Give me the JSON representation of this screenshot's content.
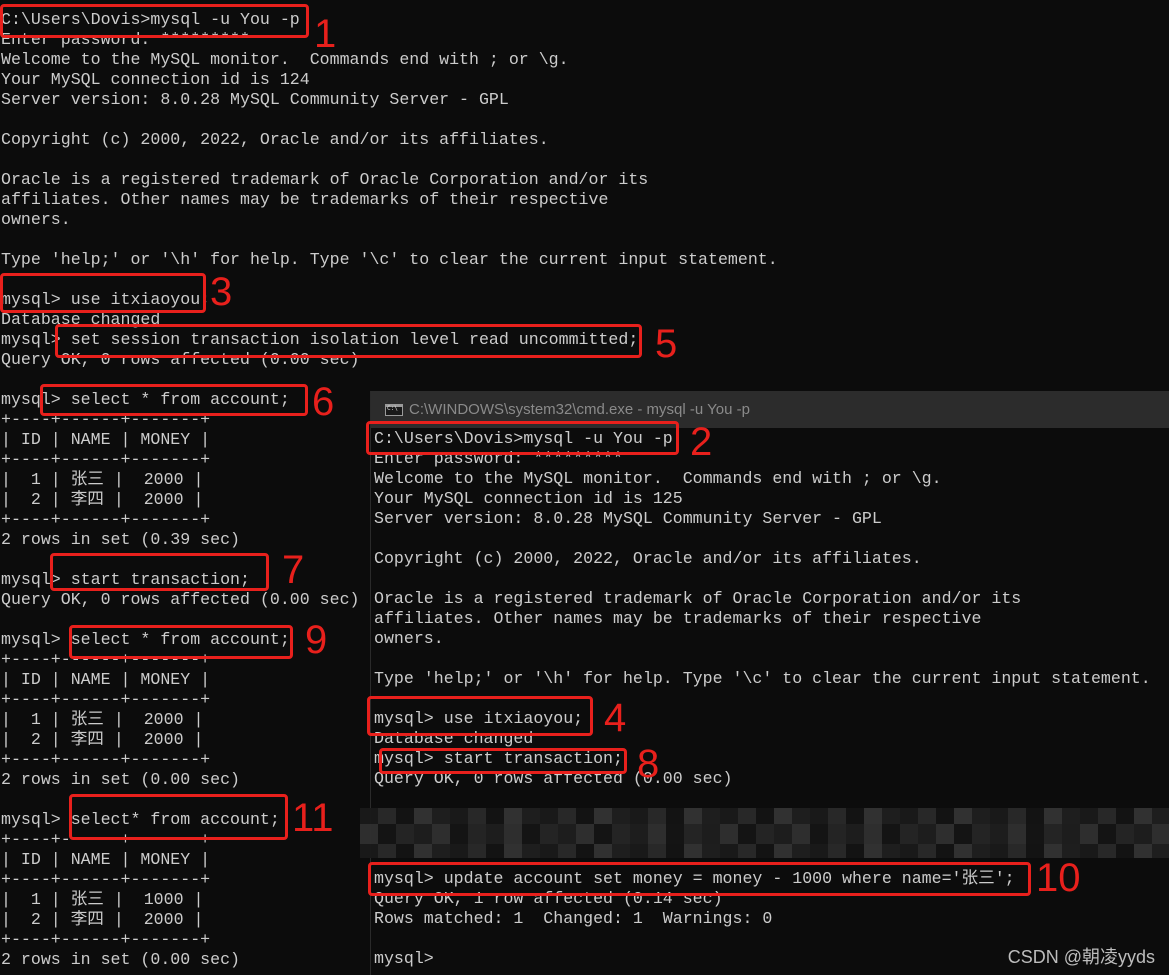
{
  "window1": {
    "lines": [
      "C:\\Users\\Dovis>mysql -u You -p",
      "Enter password: *********",
      "Welcome to the MySQL monitor.  Commands end with ; or \\g.",
      "Your MySQL connection id is 124",
      "Server version: 8.0.28 MySQL Community Server - GPL",
      "",
      "Copyright (c) 2000, 2022, Oracle and/or its affiliates.",
      "",
      "Oracle is a registered trademark of Oracle Corporation and/or its",
      "affiliates. Other names may be trademarks of their respective",
      "owners.",
      "",
      "Type 'help;' or '\\h' for help. Type '\\c' to clear the current input statement.",
      "",
      "mysql> use itxiaoyou;",
      "Database changed",
      "mysql> set session transaction isolation level read uncommitted;",
      "Query OK, 0 rows affected (0.00 sec)",
      "",
      "mysql> select * from account;",
      "+----+------+-------+",
      "| ID | NAME | MONEY |",
      "+----+------+-------+",
      "|  1 | 张三 |  2000 |",
      "|  2 | 李四 |  2000 |",
      "+----+------+-------+",
      "2 rows in set (0.39 sec)",
      "",
      "mysql> start transaction;",
      "Query OK, 0 rows affected (0.00 sec)",
      "",
      "mysql> select * from account;",
      "+----+------+-------+",
      "| ID | NAME | MONEY |",
      "+----+------+-------+",
      "|  1 | 张三 |  2000 |",
      "|  2 | 李四 |  2000 |",
      "+----+------+-------+",
      "2 rows in set (0.00 sec)",
      "",
      "mysql> select* from account;",
      "+----+------+-------+",
      "| ID | NAME | MONEY |",
      "+----+------+-------+",
      "|  1 | 张三 |  1000 |",
      "|  2 | 李四 |  2000 |",
      "+----+------+-------+",
      "2 rows in set (0.00 sec)"
    ]
  },
  "window2": {
    "title": "C:\\WINDOWS\\system32\\cmd.exe - mysql  -u You -p",
    "icon": "cmd-icon",
    "lines": [
      "C:\\Users\\Dovis>mysql -u You -p",
      "Enter password: *********",
      "Welcome to the MySQL monitor.  Commands end with ; or \\g.",
      "Your MySQL connection id is 125",
      "Server version: 8.0.28 MySQL Community Server - GPL",
      "",
      "Copyright (c) 2000, 2022, Oracle and/or its affiliates.",
      "",
      "Oracle is a registered trademark of Oracle Corporation and/or its",
      "affiliates. Other names may be trademarks of their respective",
      "owners.",
      "",
      "Type 'help;' or '\\h' for help. Type '\\c' to clear the current input statement.",
      "",
      "mysql> use itxiaoyou;",
      "Database changed",
      "mysql> start transaction;",
      "Query OK, 0 rows affected (0.00 sec)",
      "",
      "",
      "",
      "",
      "mysql> update account set money = money - 1000 where name='张三';",
      "Query OK, 1 row affected (0.14 sec)",
      "Rows matched: 1  Changed: 1  Warnings: 0",
      "",
      "mysql>"
    ]
  },
  "annotations": {
    "step_labels": [
      "1",
      "2",
      "3",
      "4",
      "5",
      "6",
      "7",
      "8",
      "9",
      "10",
      "11"
    ],
    "color": "#e8201c"
  },
  "watermark": "CSDN @朝凌yyds"
}
